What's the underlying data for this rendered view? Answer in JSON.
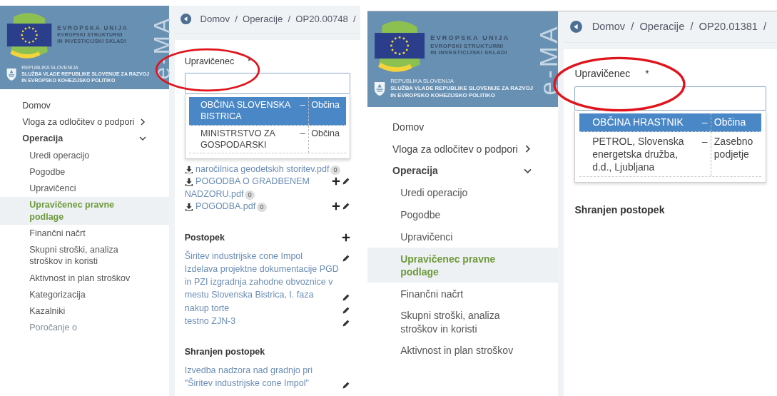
{
  "panels": [
    {
      "logo": {
        "eu_lines": [
          "EVROPSKA UNIJA",
          "EVROPSKI STRUKTURNI",
          "IN INVESTICIJSKI SKLADI"
        ],
        "gov_lines": [
          "REPUBLIKA SLOVENIJA",
          "SLUŽBA VLADE REPUBLIKE SLOVENIJE ZA RAZVOJ",
          "IN EVROPSKO KOHEZIJSKO POLITIKO"
        ],
        "brand": "e-MA"
      },
      "nav": [
        {
          "label": "Domov"
        },
        {
          "label": "Vloga za odločitev o podpori",
          "expanded": false
        },
        {
          "label": "Operacija",
          "expanded": true,
          "children": [
            {
              "label": "Uredi operacijo",
              "selected": false
            },
            {
              "label": "Pogodbe",
              "selected": false
            },
            {
              "label": "Upravičenci",
              "selected": false
            },
            {
              "label": "Upravičenec pravne podlage",
              "selected": true
            },
            {
              "label": "Finančni načrt",
              "selected": false
            },
            {
              "label": "Skupni stroški, analiza stroškov in koristi",
              "selected": false
            },
            {
              "label": "Aktivnost in plan stroškov",
              "selected": false
            },
            {
              "label": "Kategorizacija",
              "selected": false
            },
            {
              "label": "Kazalniki",
              "selected": false
            },
            {
              "label": "Poročanje o",
              "selected": false
            }
          ]
        }
      ],
      "breadcrumb": {
        "separator": "/",
        "items": [
          "Domov",
          "Operacije",
          "OP20.00748"
        ]
      },
      "field": {
        "label": "Upravičenec",
        "required": "*"
      },
      "options": [
        {
          "name": "OBČINA SLOVENSKA BISTRICA",
          "dash": "–",
          "type": "Občina",
          "selected": true
        },
        {
          "name": "MINISTRSTVO ZA GOSPODARSKI",
          "dash": "–",
          "type": "Občina",
          "selected": false
        }
      ],
      "files": [
        {
          "name": "naročilnica geodetskih storitev.pdf",
          "count": "0",
          "actions": false
        },
        {
          "name": "POGODBA O GRADBENEM NADZORU.pdf",
          "count": "0",
          "actions": true
        },
        {
          "name": "POGODBA.pdf",
          "count": "0",
          "actions": true
        }
      ],
      "procedures": {
        "title": "Postopek",
        "items": [
          {
            "name": "Širitev industrijske cone Impol"
          },
          {
            "name": "Izdelava projektne dokumentacije PGD in PZI izgradnja zahodne obvoznice v mestu Slovenska Bistrica, I. faza"
          },
          {
            "name": "nakup torte"
          },
          {
            "name": "testno ZJN-3"
          }
        ]
      },
      "saved": {
        "title": "Shranjen postopek",
        "items": [
          {
            "name": "Izvedba nadzora nad gradnjo pri \"Širitev industrijske cone Impol\""
          }
        ]
      }
    },
    {
      "logo": {
        "eu_lines": [
          "EVROPSKA UNIJA",
          "EVROPSKI STRUKTURNI",
          "IN INVESTICIJSKI SKLADI"
        ],
        "gov_lines": [
          "REPUBLIKA SLOVENIJA",
          "SLUŽBA VLADE REPUBLIKE SLOVENIJE ZA RAZVOJ",
          "IN EVROPSKO KOHEZIJSKO POLITIKO"
        ],
        "brand": "e-MA"
      },
      "nav": [
        {
          "label": "Domov"
        },
        {
          "label": "Vloga za odločitev o podpori",
          "expanded": false
        },
        {
          "label": "Operacija",
          "expanded": true,
          "children": [
            {
              "label": "Uredi operacijo",
              "selected": false
            },
            {
              "label": "Pogodbe",
              "selected": false
            },
            {
              "label": "Upravičenci",
              "selected": false
            },
            {
              "label": "Upravičenec pravne podlage",
              "selected": true
            },
            {
              "label": "Finančni načrt",
              "selected": false
            },
            {
              "label": "Skupni stroški, analiza stroškov in koristi",
              "selected": false
            },
            {
              "label": "Aktivnost in plan stroškov",
              "selected": false
            }
          ]
        }
      ],
      "breadcrumb": {
        "separator": "/",
        "items": [
          "Domov",
          "Operacije",
          "OP20.01381"
        ]
      },
      "field": {
        "label": "Upravičenec",
        "required": "*"
      },
      "options": [
        {
          "name": "OBČINA HRASTNIK",
          "dash": "–",
          "type": "Občina",
          "selected": true
        },
        {
          "name": "PETROL, Slovenska energetska družba, d.d., Ljubljana",
          "dash": "–",
          "type": "Zasebno podjetje",
          "selected": false
        }
      ],
      "saved": {
        "title": "Shranjen postopek"
      }
    }
  ]
}
